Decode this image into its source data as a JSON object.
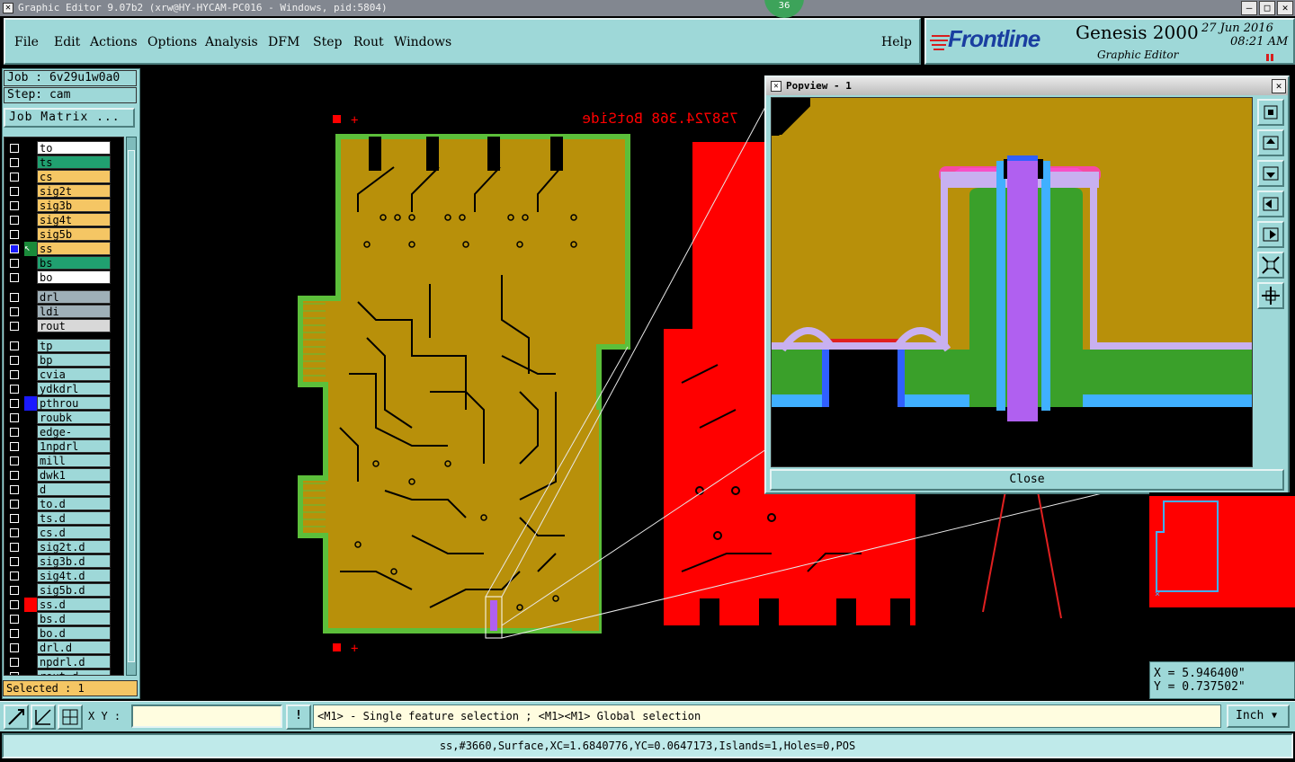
{
  "window": {
    "title": "Graphic Editor 9.07b2 (xrw@HY-HYCAM-PC016 - Windows, pid:5804)",
    "badge": "36"
  },
  "menu": {
    "items": [
      "File",
      "Edit",
      "Actions",
      "Options",
      "Analysis",
      "DFM",
      "Step",
      "Rout",
      "Windows"
    ],
    "help": "Help"
  },
  "brand": {
    "logo": "Frontline",
    "product": "Genesis 2000",
    "subtitle": "Graphic Editor",
    "date": "27 Jun 2016",
    "time": "08:21 AM"
  },
  "job": {
    "job_label": "Job : 6v29u1w0a0",
    "step_label": "Step: cam",
    "matrix_button": "Job Matrix ..."
  },
  "layers": [
    {
      "name": "to",
      "color": "#ffffff",
      "swatch": "#000000",
      "checked": false
    },
    {
      "name": "ts",
      "color": "#20a070",
      "swatch": "#000000",
      "checked": false
    },
    {
      "name": "cs",
      "color": "#f5c664",
      "swatch": "#000000",
      "checked": false
    },
    {
      "name": "sig2t",
      "color": "#f5c664",
      "swatch": "#000000",
      "checked": false
    },
    {
      "name": "sig3b",
      "color": "#f5c664",
      "swatch": "#000000",
      "checked": false
    },
    {
      "name": "sig4t",
      "color": "#f5c664",
      "swatch": "#000000",
      "checked": false
    },
    {
      "name": "sig5b",
      "color": "#f5c664",
      "swatch": "#000000",
      "checked": false
    },
    {
      "name": "ss",
      "color": "#f5c664",
      "swatch": "#1a8a3a",
      "checked": true
    },
    {
      "name": "bs",
      "color": "#20a070",
      "swatch": "#000000",
      "checked": false
    },
    {
      "name": "bo",
      "color": "#ffffff",
      "swatch": "#000000",
      "checked": false
    },
    {
      "name": "drl",
      "color": "#9fb0b8",
      "swatch": "#000000",
      "checked": false
    },
    {
      "name": "ldi",
      "color": "#9fb0b8",
      "swatch": "#000000",
      "checked": false
    },
    {
      "name": "rout",
      "color": "#d8d8d8",
      "swatch": "#000000",
      "checked": false
    },
    {
      "name": "tp",
      "color": "#9ed8d8",
      "swatch": "#000000",
      "checked": false
    },
    {
      "name": "bp",
      "color": "#9ed8d8",
      "swatch": "#000000",
      "checked": false
    },
    {
      "name": "cvia",
      "color": "#9ed8d8",
      "swatch": "#000000",
      "checked": false
    },
    {
      "name": "ydkdrl",
      "color": "#9ed8d8",
      "swatch": "#000000",
      "checked": false
    },
    {
      "name": "pthrou",
      "color": "#9ed8d8",
      "swatch": "#1a1aff",
      "checked": false
    },
    {
      "name": "roubk",
      "color": "#9ed8d8",
      "swatch": "#000000",
      "checked": false
    },
    {
      "name": "edge-plated",
      "color": "#9ed8d8",
      "swatch": "#000000",
      "checked": false
    },
    {
      "name": "1npdrl",
      "color": "#9ed8d8",
      "swatch": "#000000",
      "checked": false
    },
    {
      "name": "mill",
      "color": "#9ed8d8",
      "swatch": "#000000",
      "checked": false
    },
    {
      "name": "dwk1",
      "color": "#9ed8d8",
      "swatch": "#000000",
      "checked": false
    },
    {
      "name": "d",
      "color": "#9ed8d8",
      "swatch": "#000000",
      "checked": false
    },
    {
      "name": "to.d",
      "color": "#9ed8d8",
      "swatch": "#000000",
      "checked": false
    },
    {
      "name": "ts.d",
      "color": "#9ed8d8",
      "swatch": "#000000",
      "checked": false
    },
    {
      "name": "cs.d",
      "color": "#9ed8d8",
      "swatch": "#000000",
      "checked": false
    },
    {
      "name": "sig2t.d",
      "color": "#9ed8d8",
      "swatch": "#000000",
      "checked": false
    },
    {
      "name": "sig3b.d",
      "color": "#9ed8d8",
      "swatch": "#000000",
      "checked": false
    },
    {
      "name": "sig4t.d",
      "color": "#9ed8d8",
      "swatch": "#000000",
      "checked": false
    },
    {
      "name": "sig5b.d",
      "color": "#9ed8d8",
      "swatch": "#000000",
      "checked": false
    },
    {
      "name": "ss.d",
      "color": "#9ed8d8",
      "swatch": "#ff0000",
      "checked": false
    },
    {
      "name": "bs.d",
      "color": "#9ed8d8",
      "swatch": "#000000",
      "checked": false
    },
    {
      "name": "bo.d",
      "color": "#9ed8d8",
      "swatch": "#000000",
      "checked": false
    },
    {
      "name": "drl.d",
      "color": "#9ed8d8",
      "swatch": "#000000",
      "checked": false
    },
    {
      "name": "npdrl.d",
      "color": "#9ed8d8",
      "swatch": "#000000",
      "checked": false
    },
    {
      "name": "rout.d",
      "color": "#9ed8d8",
      "swatch": "#000000",
      "checked": false
    }
  ],
  "selection": {
    "label": "Selected : 1"
  },
  "canvas": {
    "board_label": "758724.368 BotSide",
    "colors": {
      "board": "#b8900a",
      "outline": "#5cbf3a",
      "second_board": "#ff0000"
    }
  },
  "popview": {
    "title": "Popview - 1",
    "close_label": "Close"
  },
  "coords": {
    "x": "X = 5.946400\"",
    "y": "Y = 0.737502\""
  },
  "toolbar": {
    "xy_label": "X Y :",
    "xy_value": "",
    "hint": "<M1> - Single feature selection ; <M1><M1> Global selection",
    "unit": "Inch"
  },
  "status": {
    "text": "ss,#3660,Surface,XC=1.6840776,YC=0.0647173,Islands=1,Holes=0,POS"
  }
}
